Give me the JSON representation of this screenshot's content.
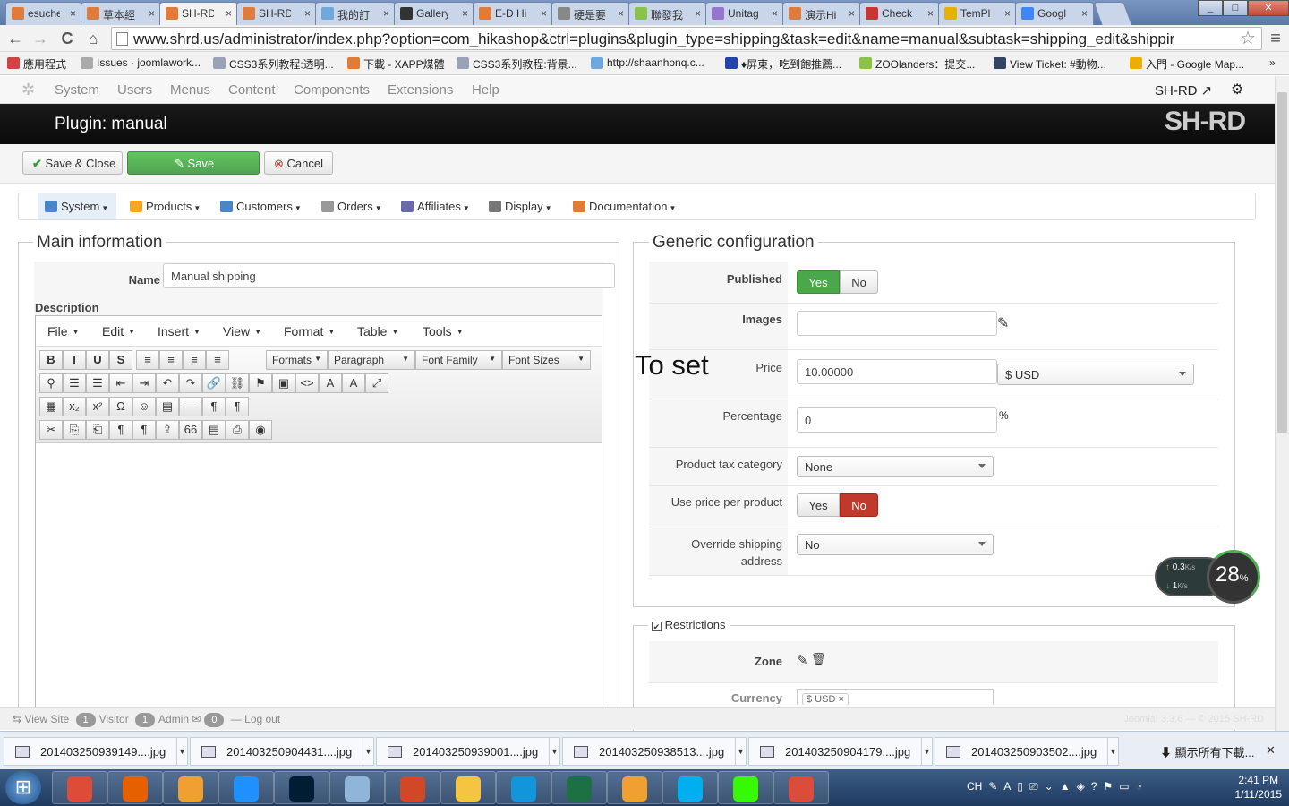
{
  "browser": {
    "tabs": [
      {
        "label": "esuche",
        "color": "#e07b39"
      },
      {
        "label": "草本經",
        "color": "#e07b39"
      },
      {
        "label": "SH-RD",
        "color": "#e07b39",
        "active": true
      },
      {
        "label": "SH-RD",
        "color": "#e07b39"
      },
      {
        "label": "我的訂",
        "color": "#6fa8dc"
      },
      {
        "label": "Gallery",
        "color": "#333333"
      },
      {
        "label": "E-D Hi",
        "color": "#e07b39"
      },
      {
        "label": "硬是要",
        "color": "#888888"
      },
      {
        "label": "聯發我",
        "color": "#8bc34a"
      },
      {
        "label": "Unitag",
        "color": "#9575cd"
      },
      {
        "label": "演示Hi",
        "color": "#e07b39"
      },
      {
        "label": "Check",
        "color": "#cc3333"
      },
      {
        "label": "TemPl",
        "color": "#e8b100"
      },
      {
        "label": "Googl",
        "color": "#4285f4"
      }
    ],
    "tab_close": "×",
    "window_buttons": {
      "minimize": "_",
      "maximize": "□",
      "close": "✕"
    },
    "nav": {
      "back": "←",
      "forward": "→",
      "reload": "C",
      "home": "⌂"
    },
    "url": "www.shrd.us/administrator/index.php?option=com_hikashop&ctrl=plugins&plugin_type=shipping&task=edit&name=manual&subtask=shipping_edit&shippir",
    "star": "☆",
    "menu_icon": "≡",
    "bookmarks": [
      {
        "label": "應用程式",
        "color": "#cc4444"
      },
      {
        "label": "Issues · joomlawork...",
        "color": "#aaaaaa"
      },
      {
        "label": "CSS3系列教程:透明...",
        "color": "#9aa3b5"
      },
      {
        "label": "下載 - XAPP煤體",
        "color": "#e07b39"
      },
      {
        "label": "CSS3系列教程:背景...",
        "color": "#9aa3b5"
      },
      {
        "label": "http://shaanhonq.c...",
        "color": "#6fa8dc"
      },
      {
        "label": "♦屏東，吃到飽推薦...",
        "color": "#2244aa"
      },
      {
        "label": "ZOOlanders：提交...",
        "color": "#8bc34a"
      },
      {
        "label": "View Ticket: #動物...",
        "color": "#334466"
      },
      {
        "label": "入門 - Google Map...",
        "color": "#e8b100"
      }
    ],
    "bookmarks_more": "»"
  },
  "joomla": {
    "menu": [
      "System",
      "Users",
      "Menus",
      "Content",
      "Components",
      "Extensions",
      "Help"
    ],
    "site_link": "SH-RD",
    "gear": "⚙",
    "page_title": "Plugin: manual",
    "brand": "SH-RD",
    "actions": {
      "save_close": "Save & Close",
      "save": "Save",
      "cancel": "Cancel"
    },
    "status": {
      "view_site": "View Site",
      "visitor_count": "1",
      "visitor_label": "Visitor",
      "admin_count": "1",
      "admin_label": "Admin",
      "msg_count": "0",
      "logout": "Log out",
      "version": "Joomla! 3.3.6 — © 2015 SH-RD"
    }
  },
  "hikashop_nav": [
    {
      "label": "System",
      "color": "#4a86c5",
      "active": true
    },
    {
      "label": "Products",
      "color": "#f5a623"
    },
    {
      "label": "Customers",
      "color": "#4a86c5"
    },
    {
      "label": "Orders",
      "color": "#999999"
    },
    {
      "label": "Affiliates",
      "color": "#6a6aaa"
    },
    {
      "label": "Display",
      "color": "#777777"
    },
    {
      "label": "Documentation",
      "color": "#e07b39"
    }
  ],
  "main_info": {
    "legend": "Main information",
    "name_label": "Name",
    "name_value": "Manual shipping",
    "description_label": "Description"
  },
  "editor": {
    "menus": [
      "File",
      "Edit",
      "Insert",
      "View",
      "Format",
      "Table",
      "Tools"
    ],
    "dropdowns": [
      "Formats",
      "Paragraph",
      "Font Family",
      "Font Sizes"
    ],
    "row1": [
      "B",
      "I",
      "U",
      "S",
      "≡",
      "≡",
      "≡",
      "≡"
    ],
    "row2": [
      "⚲",
      "☰",
      "☰",
      "⇤",
      "⇥",
      "↶",
      "↷",
      "🔗",
      "⛓",
      "⚑",
      "▣",
      "<>",
      "A",
      "A",
      "⤢"
    ],
    "row3": [
      "▦",
      "x₂",
      "x²",
      "Ω",
      "☺",
      "▤",
      "—",
      "¶",
      "¶"
    ],
    "row4": [
      "✂",
      "⎘",
      "⎗",
      "¶",
      "¶",
      "⇪",
      "66",
      "▤",
      "⎙",
      "◉"
    ]
  },
  "generic": {
    "legend": "Generic configuration",
    "published_label": "Published",
    "yes": "Yes",
    "no": "No",
    "images_label": "Images",
    "edit_icon": "✎",
    "annotation": "To set",
    "price_label": "Price",
    "price_value": "10.00000",
    "currency_value": "$ USD",
    "percentage_label": "Percentage",
    "percentage_value": "0",
    "percent_sign": "%",
    "tax_label": "Product tax category",
    "tax_value": "None",
    "price_per_product_label": "Use price per product",
    "override_label_1": "Override shipping",
    "override_label_2": "address",
    "override_value": "No"
  },
  "restrictions": {
    "legend": "Restrictions",
    "checkbox": "✔",
    "zone_label": "Zone",
    "trash_icon": "🗑",
    "currency_label": "Currency",
    "currency_tag": "$ USD ×"
  },
  "net_meter": {
    "up": "0.3",
    "down": "1",
    "unit": "K/s",
    "percent": "28",
    "percent_sign": "%"
  },
  "downloads": {
    "items": [
      "201403250939149....jpg",
      "201403250904431....jpg",
      "201403250939001....jpg",
      "201403250938513....jpg",
      "201403250904179....jpg",
      "201403250903502....jpg"
    ],
    "caret": "▼",
    "show_all": "顯示所有下載...",
    "close": "✕"
  },
  "taskbar": {
    "start": "⊞",
    "apps": [
      {
        "name": "chrome",
        "color": "#dd4b39"
      },
      {
        "name": "firefox",
        "color": "#e66000"
      },
      {
        "name": "media-player",
        "color": "#f0a030"
      },
      {
        "name": "internet-explorer",
        "color": "#1e90ff"
      },
      {
        "name": "photoshop",
        "color": "#001d34"
      },
      {
        "name": "notepad",
        "color": "#8fb6d8"
      },
      {
        "name": "powerpoint",
        "color": "#d24726"
      },
      {
        "name": "explorer",
        "color": "#f5c542"
      },
      {
        "name": "qq",
        "color": "#1296db"
      },
      {
        "name": "excel",
        "color": "#1d7044"
      },
      {
        "name": "outlook",
        "color": "#f0a030"
      },
      {
        "name": "skype",
        "color": "#00aff0"
      },
      {
        "name": "dreamweaver",
        "color": "#35fa00"
      },
      {
        "name": "chrome-2",
        "color": "#dd4b39"
      }
    ],
    "tray": [
      "CH",
      "✎",
      "A",
      "▯",
      "⎚",
      "⌄",
      "▲",
      "◈",
      "?",
      "⚑",
      "▭",
      "◔"
    ],
    "time": "2:41 PM",
    "date": "1/11/2015"
  }
}
